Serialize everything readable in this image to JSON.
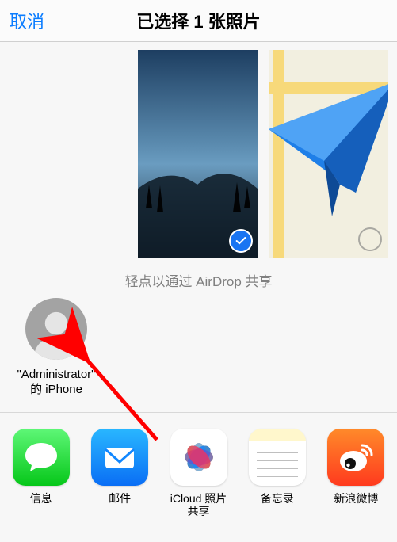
{
  "header": {
    "cancel_label": "取消",
    "title": "已选择 1 张照片"
  },
  "airdrop": {
    "caption": "轻点以通过 AirDrop 共享",
    "contacts": [
      {
        "label": "\"Administrator\"的 iPhone"
      }
    ]
  },
  "apps": [
    {
      "id": "messages",
      "label": "信息"
    },
    {
      "id": "mail",
      "label": "邮件"
    },
    {
      "id": "icloud",
      "label": "iCloud 照片共享"
    },
    {
      "id": "notes",
      "label": "备忘录"
    },
    {
      "id": "weibo",
      "label": "新浪微博"
    }
  ],
  "colors": {
    "accent": "#0a7cff",
    "check": "#1974f2",
    "arrow": "#ff0000"
  }
}
